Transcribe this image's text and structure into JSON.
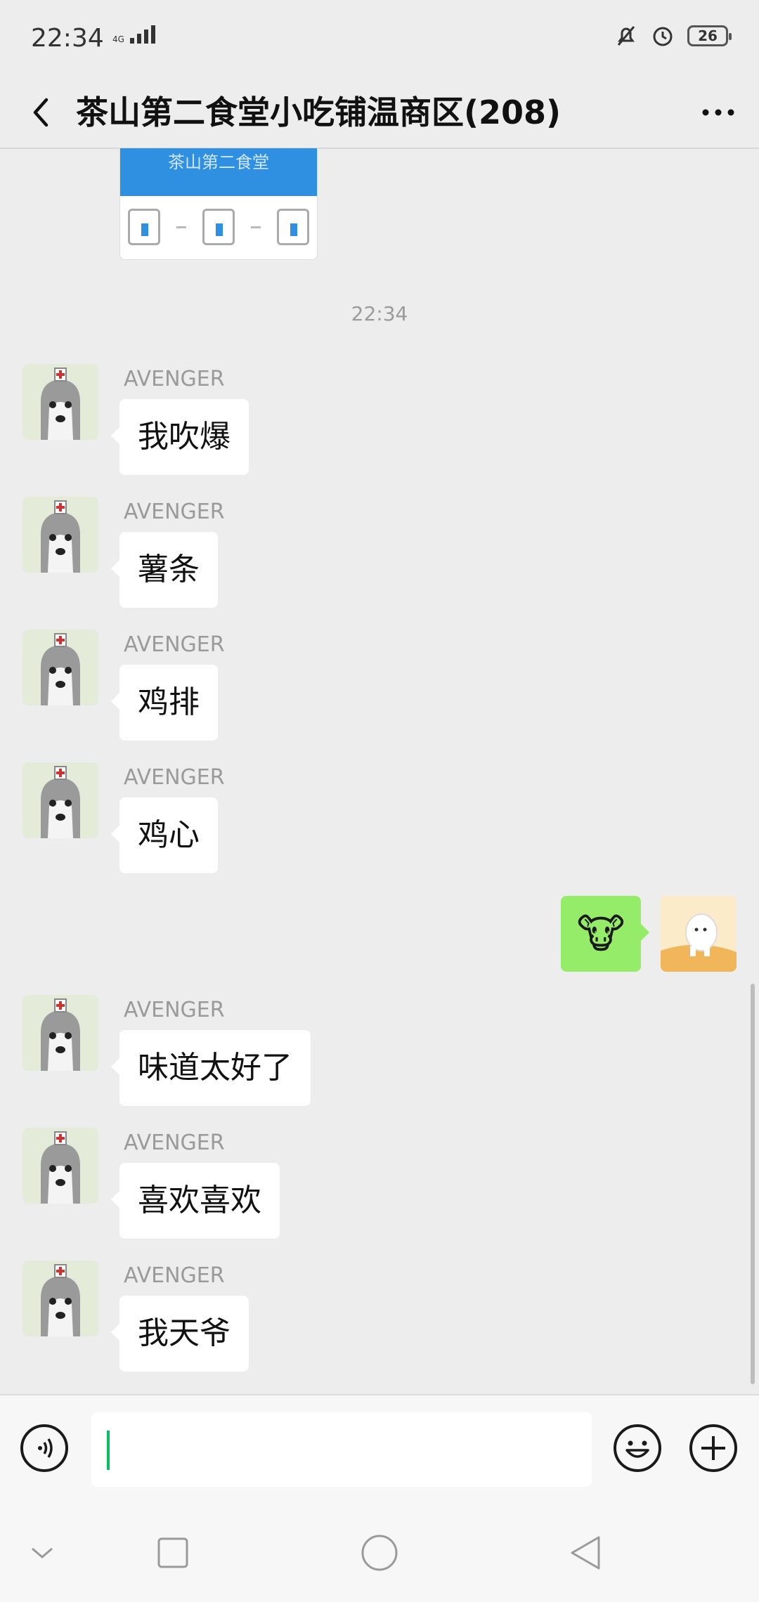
{
  "status_bar": {
    "time": "22:34",
    "network": "4G",
    "battery": "26"
  },
  "header": {
    "title": "茶山第二食堂小吃铺温商区(208)"
  },
  "shared_image": {
    "caption": "茶山第二食堂"
  },
  "timestamp": "22:34",
  "messages": [
    {
      "sender": "AVENGER",
      "text": "我吹爆"
    },
    {
      "sender": "AVENGER",
      "text": "薯条"
    },
    {
      "sender": "AVENGER",
      "text": "鸡排"
    },
    {
      "sender": "AVENGER",
      "text": "鸡心"
    },
    {
      "sender": "AVENGER",
      "text": "味道太好了"
    },
    {
      "sender": "AVENGER",
      "text": "喜欢喜欢"
    },
    {
      "sender": "AVENGER",
      "text": "我天爷"
    }
  ],
  "self_message": {
    "emoji": "🐮"
  },
  "input": {
    "value": ""
  },
  "colors": {
    "background": "#EDEDED",
    "self_bubble": "#95EC69",
    "caret": "#07C160"
  }
}
